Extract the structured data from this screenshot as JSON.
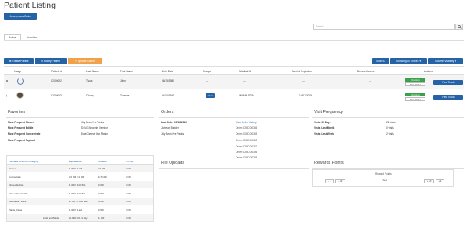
{
  "page": {
    "title": "Patient Listing"
  },
  "toolbar": {
    "anonymous_order": "Anonymous Order"
  },
  "tabs": [
    {
      "label": "Active"
    },
    {
      "label": "Inactive"
    }
  ],
  "search": {
    "placeholder": "Search",
    "icon": "search-icon"
  },
  "actions": {
    "create_patient": "Create Patient",
    "modify_patient": "Modify Patient",
    "update_search": "Update Search",
    "scan_id": "Scan ID",
    "showing": "Showing 20 Entries",
    "column_visibility": "Column Visibility"
  },
  "table": {
    "headers": [
      "Image",
      "Patient Id",
      "Last Name",
      "First Name",
      "Birth Date",
      "Groups",
      "Medical Id",
      "Med Id Expiration",
      "Drivers License",
      "Actions"
    ],
    "rows": [
      {
        "patient_id": "CI000002",
        "last_name": "Tylus",
        "first_name": "John",
        "birth_date": "06/15/1980",
        "groups": "---",
        "medical_id": "---",
        "med_id_exp": "---",
        "license": "---",
        "checkin": "Check-in",
        "start_order": "Start Order",
        "fast_track": "Fast Track"
      },
      {
        "patient_id": "CI000003",
        "last_name": "Chong",
        "first_name": "Thomas",
        "birth_date": "04/30/1947",
        "groups": "View",
        "medical_id": "WAMMJ1234",
        "med_id_exp": "12/07/2019",
        "license": "---",
        "checkin": "Check-in",
        "start_order": "Start Order",
        "fast_track": "Fast Track"
      }
    ]
  },
  "favorites": {
    "title": "Favorites",
    "items": [
      {
        "label": "Most Frequent Flower",
        "value": "Jilly Bean Pre Packs"
      },
      {
        "label": "Most Frequent Edible",
        "value": "50 MG Brownie (Vendor)"
      },
      {
        "label": "Most Frequent Concentrate",
        "value": "Blue Cheese Live Resin"
      },
      {
        "label": "Most Frequent Topical",
        "value": ""
      }
    ]
  },
  "orders": {
    "title": "Orders",
    "last_order": "Last Order 06/18/2019",
    "history_link": "View Order History",
    "products": [
      "Jilybean Budder",
      "Jilly Bean Pre Packs"
    ],
    "order_list": [
      "Order: CRID 00366",
      "Order: CRID 00365",
      "Order: CRID 00363",
      "Order: CRID 00357",
      "Order: CRID 00356",
      "Order: CRID 00355"
    ]
  },
  "visits": {
    "title": "Visit Frequency",
    "items": [
      {
        "label": "Visits 90 Days",
        "value": "22 visits"
      },
      {
        "label": "Visits Last Month",
        "value": "0 visits"
      },
      {
        "label": "Visits Last Week",
        "value": "2 visits"
      }
    ]
  },
  "limits": {
    "headers": [
      "Purchase Limits By Category",
      "Equivalence",
      "Ordered",
      "In Order"
    ],
    "rows": [
      [
        "Flower",
        "1 OR = 1 OR",
        "2.5 OR",
        "0 OR"
      ],
      [
        "Concentrate",
        "2.5 OR = 1 OR",
        "10.5 OR",
        "0 OR"
      ],
      [
        "Infused Edible",
        "1 OR = 100 MG",
        "0 OR",
        "0 OR"
      ],
      [
        "Infused Non-Edible",
        "1 OR = 100 MG",
        "0 OR",
        "0 OR"
      ],
      [
        "Cartridges / Pens",
        "25 OR = 2000 MG",
        "0 OR",
        "0 OR"
      ],
      [
        "Plants, Clone",
        "1 OR = 1 EA",
        "0 OR",
        "0 OR"
      ]
    ],
    "total": [
      "Limit and Totals",
      "28.000 OR / 1 day",
      "14 OR",
      "0 OR"
    ]
  },
  "uploads": {
    "title": "File Uploads"
  },
  "rewards": {
    "title": "Rewards Points",
    "label": "Reward Points",
    "value": "7300",
    "minus1": "− 1",
    "minus10": "− 10",
    "plus10": "+ 10",
    "plus1": "+ 1"
  },
  "colors": {
    "primary": "#2563a6",
    "orange": "#f0a24a",
    "green": "#3aa14a"
  }
}
